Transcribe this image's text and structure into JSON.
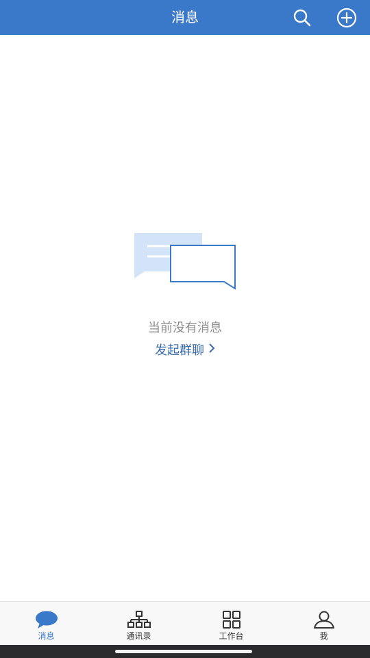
{
  "header": {
    "title": "消息",
    "search_icon": "search-icon",
    "add_icon": "add-circle-icon",
    "bg_color": "#3a78c9"
  },
  "empty_state": {
    "illustration_icon": "chat-bubbles-icon",
    "message": "当前没有消息",
    "action_label": "发起群聊",
    "action_icon": "chevron-right-icon"
  },
  "tabbar": {
    "items": [
      {
        "label": "消息",
        "icon": "chat-bubble-icon",
        "active": true
      },
      {
        "label": "通讯录",
        "icon": "org-chart-icon",
        "active": false
      },
      {
        "label": "工作台",
        "icon": "grid-icon",
        "active": false
      },
      {
        "label": "我",
        "icon": "person-icon",
        "active": false
      }
    ]
  },
  "colors": {
    "accent": "#3a78c9",
    "link": "#3a6aa8",
    "muted_text": "#8c8c8c"
  }
}
